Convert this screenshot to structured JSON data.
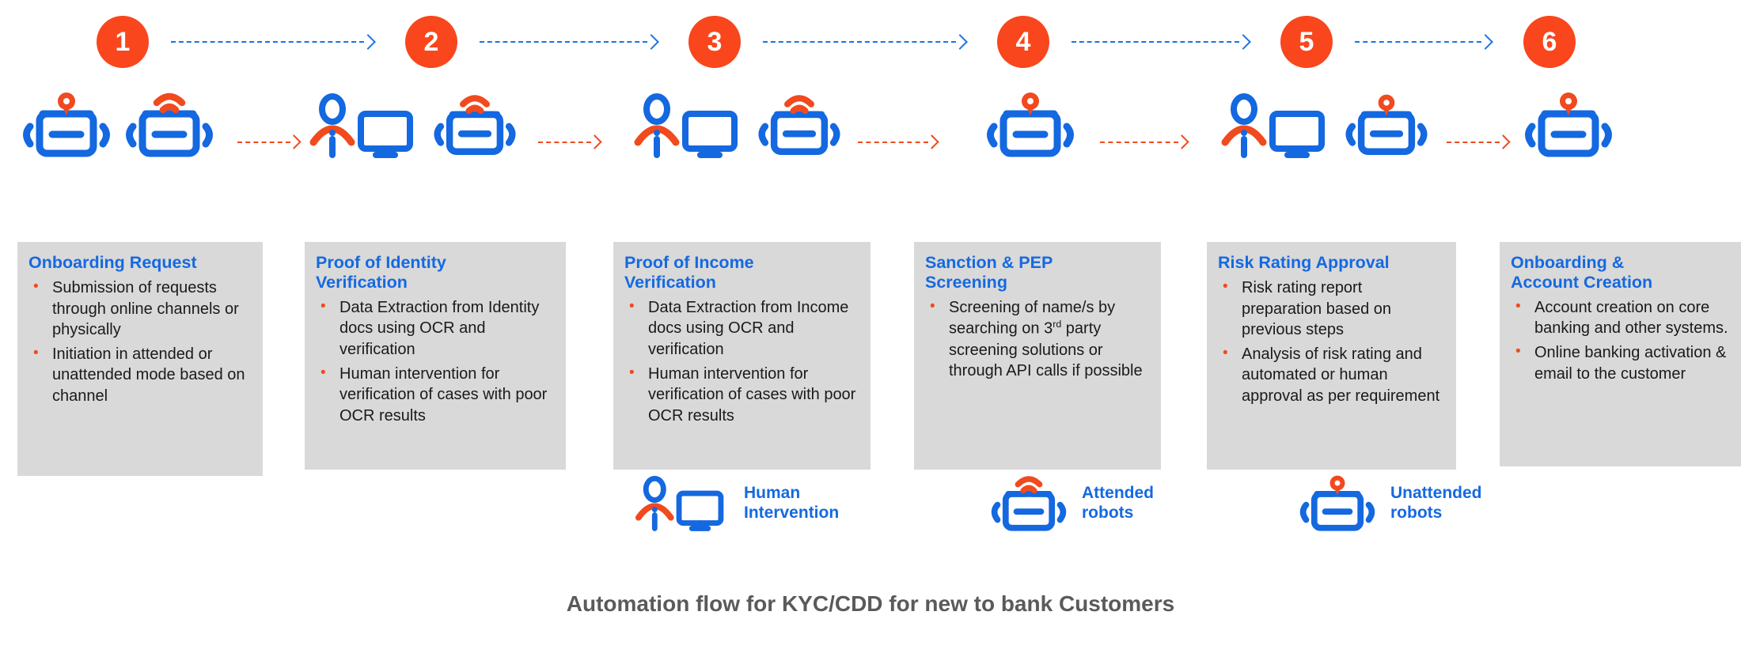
{
  "colors": {
    "accent_orange": "#F9461C",
    "icon_orange": "#F04A1E",
    "heading_blue": "#1569E0",
    "icon_blue": "#1468E0",
    "arrow_blue": "#1A73E8",
    "card_bg": "#D9D9D9",
    "caption_grey": "#5A5A5A",
    "body_text": "#1a1a1a"
  },
  "caption": "Automation flow for KYC/CDD for new to bank Customers",
  "steps": [
    {
      "number": "1",
      "icons": [
        "unattended-robot-icon",
        "attended-robot-icon"
      ],
      "title": "Onboarding Request",
      "bullets": [
        "Submission of requests through online channels or physically",
        "Initiation in attended or unattended mode based on channel"
      ]
    },
    {
      "number": "2",
      "icons": [
        "human-intervention-icon",
        "attended-robot-icon"
      ],
      "title": "Proof of Identity\nVerification",
      "bullets": [
        "Data Extraction from Identity docs using OCR and verification",
        "Human intervention  for verification  of cases with poor OCR  results"
      ]
    },
    {
      "number": "3",
      "icons": [
        "human-intervention-icon",
        "attended-robot-icon"
      ],
      "title": "Proof of Income\nVerification",
      "bullets": [
        "Data Extraction from Income docs using OCR and verification",
        "Human intervention  for verification  of cases with poor OCR  results"
      ]
    },
    {
      "number": "4",
      "icons": [
        "unattended-robot-icon"
      ],
      "title": "Sanction & PEP\nScreening",
      "bullets": [
        "Screening of name/s by searching on 3||rd|| party screening solutions or through API calls if possible"
      ]
    },
    {
      "number": "5",
      "icons": [
        "human-intervention-icon",
        "unattended-robot-icon"
      ],
      "title": "Risk Rating Approval",
      "bullets": [
        "Risk rating report preparation  based on previous  steps",
        "Analysis of risk rating and automated or human approval  as per requirement"
      ]
    },
    {
      "number": "6",
      "icons": [
        "unattended-robot-icon"
      ],
      "title": "Onboarding &\nAccount Creation",
      "bullets": [
        "Account creation on core banking and other systems.",
        "Online banking activation & email to the customer"
      ]
    }
  ],
  "legend": [
    {
      "icon": "human-intervention-icon",
      "label": "Human\nIntervention"
    },
    {
      "icon": "attended-robot-icon",
      "label": "Attended\nrobots"
    },
    {
      "icon": "unattended-robot-icon",
      "label": "Unattended\nrobots"
    }
  ]
}
